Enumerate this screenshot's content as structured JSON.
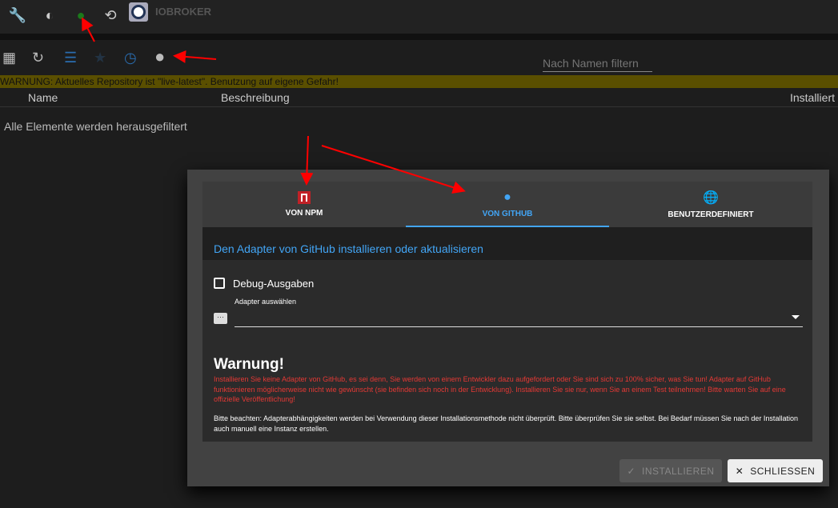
{
  "topbar": {
    "brand": "IOBROKER",
    "icons": [
      "wrench-icon",
      "brightness-icon",
      "expert-mode-icon",
      "sync-off-icon"
    ]
  },
  "toolbar": {
    "icons": [
      "grid-icon",
      "refresh-icon",
      "list-icon",
      "star-icon",
      "update-icon",
      "github-icon"
    ],
    "filter_placeholder": "Nach Namen filtern"
  },
  "warning_bar": "WARNUNG: Aktuelles Repository ist \"live-latest\". Benutzung auf eigene Gefahr!",
  "table": {
    "columns": [
      "Name",
      "Beschreibung",
      "Installiert"
    ],
    "empty": "Alle Elemente werden herausgefiltert"
  },
  "dialog": {
    "tabs": [
      {
        "label": "VON NPM",
        "icon": "npm-icon"
      },
      {
        "label": "VON GITHUB",
        "icon": "github-icon",
        "active": true
      },
      {
        "label": "BENUTZERDEFINIERT",
        "icon": "globe-icon"
      }
    ],
    "subtitle": "Den Adapter von GitHub installieren oder aktualisieren",
    "debug_label": "Debug-Ausgaben",
    "debug_checked": false,
    "select_label": "Adapter auswählen",
    "select_value": "",
    "warning_title": "Warnung!",
    "warning_text": "Installieren Sie keine Adapter von GitHub, es sei denn, Sie werden von einem Entwickler dazu aufgefordert oder Sie sind sich zu 100% sicher, was Sie tun! Adapter auf GitHub funktionieren möglicherweise nicht wie gewünscht (sie befinden sich noch in der Entwicklung). Installieren Sie sie nur, wenn Sie an einem Test teilnehmen! Bitte warten Sie auf eine offizielle Veröffentlichung!",
    "note_text": "Bitte beachten: Adapterabhängigkeiten werden bei Verwendung dieser Installationsmethode nicht überprüft. Bitte überprüfen Sie sie selbst. Bei Bedarf müssen Sie nach der Installation auch manuell eine Instanz erstellen.",
    "install_label": "INSTALLIEREN",
    "close_label": "SCHLIESSEN"
  },
  "colors": {
    "accent": "#42a5f5",
    "warning_red": "#e53935",
    "annotation": "#ff0000"
  }
}
